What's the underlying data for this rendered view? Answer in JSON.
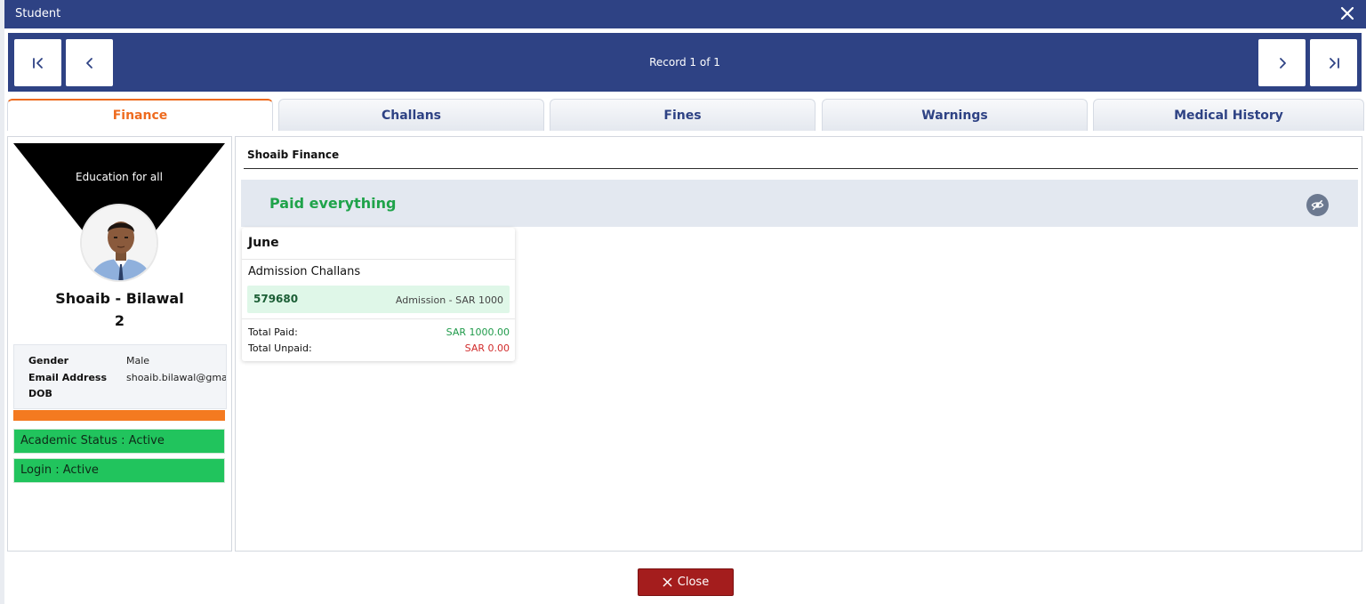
{
  "window": {
    "title": "Student"
  },
  "navigation": {
    "record_label": "Record 1 of 1"
  },
  "tabs": [
    {
      "label": "Finance",
      "active": true
    },
    {
      "label": "Challans",
      "active": false
    },
    {
      "label": "Fines",
      "active": false
    },
    {
      "label": "Warnings",
      "active": false
    },
    {
      "label": "Medical History",
      "active": false
    }
  ],
  "profile": {
    "motto": "Education for all",
    "name": "Shoaib - Bilawal",
    "id": "2",
    "details": [
      {
        "label": "Gender",
        "value": "Male"
      },
      {
        "label": "Email Address",
        "value": "shoaib.bilawal@gma"
      },
      {
        "label": "DOB",
        "value": ""
      }
    ],
    "academic_status": "Academic Status : Active",
    "login_status": "Login : Active"
  },
  "finance": {
    "heading": "Shoaib Finance",
    "status_text": "Paid everything",
    "month": "June",
    "section": "Admission Challans",
    "challan": {
      "number": "579680",
      "description": "Admission - SAR 1000"
    },
    "total_paid_label": "Total Paid:",
    "total_paid_value": "SAR 1000.00",
    "total_unpaid_label": "Total Unpaid:",
    "total_unpaid_value": "SAR 0.00"
  },
  "footer": {
    "close_label": "Close"
  },
  "colors": {
    "primary": "#2e4284",
    "accent": "#ee6b1f",
    "success": "#21c45d",
    "danger": "#a41d1d",
    "paid_text": "#1fa34a",
    "paid_value": "#1f9a4a",
    "unpaid_value": "#d12b2b"
  },
  "icons": {
    "close": "close-icon",
    "first": "first-page-icon",
    "prev": "chevron-left-icon",
    "next": "chevron-right-icon",
    "last": "last-page-icon",
    "visibility": "eye-slash-icon"
  }
}
